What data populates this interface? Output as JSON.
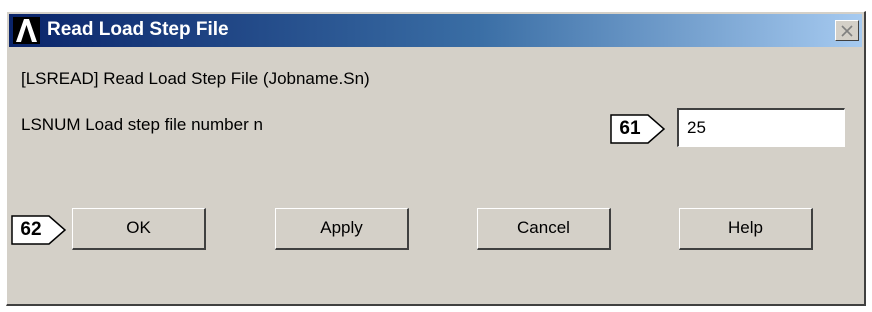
{
  "window": {
    "title": "Read Load Step File",
    "logo_icon": "ansys-logo-icon",
    "close_icon": "close-icon"
  },
  "command_label": "[LSREAD]  Read Load Step File (Jobname.Sn)",
  "lsnum": {
    "label": "LSNUM  Load step file number n",
    "value": "25"
  },
  "callouts": {
    "field": "61",
    "ok": "62"
  },
  "buttons": {
    "ok": "OK",
    "apply": "Apply",
    "cancel": "Cancel",
    "help": "Help"
  },
  "colors": {
    "title_bar_start": "#0a246a",
    "title_bar_end": "#a6caf0",
    "dialog_face": "#d4d0c8"
  }
}
